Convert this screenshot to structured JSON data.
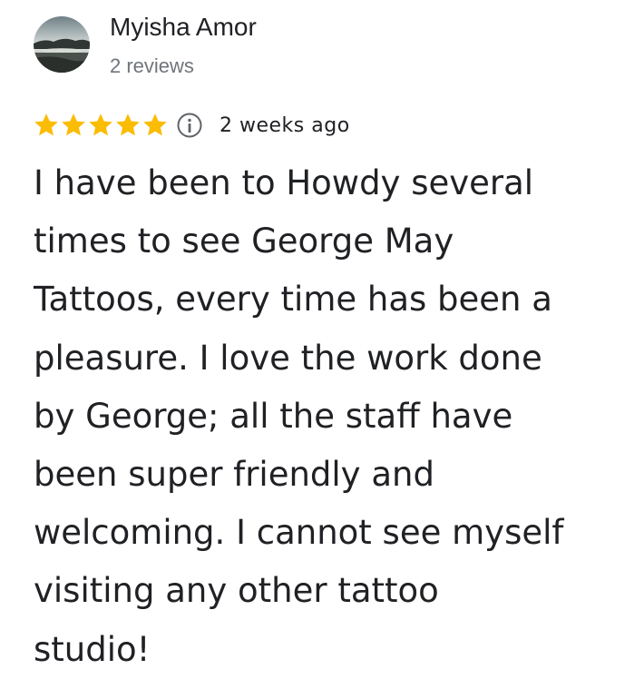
{
  "review": {
    "reviewer_name": "Myisha Amor",
    "review_count": "2 reviews",
    "rating": 5,
    "rating_max": 5,
    "star_color": "#fbbc04",
    "time_ago": "2 weeks ago",
    "text": "I have been to Howdy several\ntimes to see George May\nTattoos, every time has been a\npleasure. I love the work done\nby George; all the staff have\nbeen super friendly and\nwelcoming. I cannot see myself\nvisiting any other tattoo\nstudio!",
    "icons": {
      "avatar": "profile-photo",
      "star": "star-icon",
      "info": "info-icon"
    }
  }
}
